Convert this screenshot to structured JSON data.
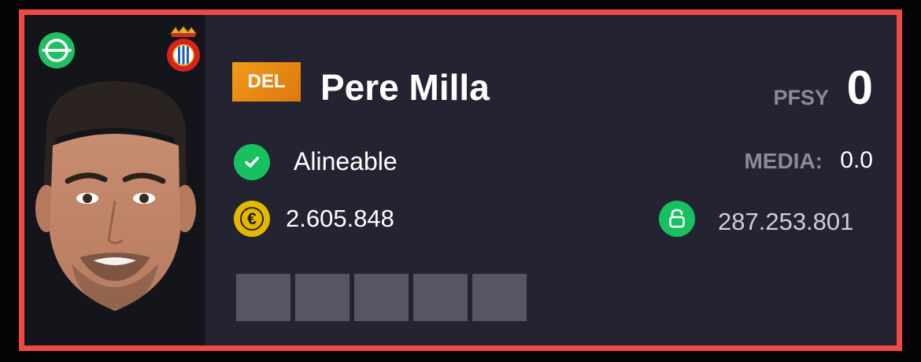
{
  "player": {
    "position": "DEL",
    "name": "Pere Milla",
    "status": "Alineable",
    "market_value": "2.605.848",
    "clause": "287.253.801"
  },
  "stats": {
    "pfsy_label": "PFSY",
    "pfsy_value": "0",
    "media_label": "MEDIA:",
    "media_value": "0.0"
  },
  "form": {
    "count": 5,
    "results": [
      "",
      "",
      "",
      "",
      ""
    ]
  },
  "icons": {
    "position": "position-circle-icon",
    "club": "club-crest-icon",
    "status": "checkmark-icon",
    "value": "euro-coin-icon",
    "clause": "unlock-icon"
  },
  "colors": {
    "border": "#ee4a43",
    "card_bg": "#232332",
    "accent_orange": "#f39b19",
    "green": "#18c160",
    "gold": "#e2b800",
    "muted": "#8a8a99",
    "form_box": "#565663"
  }
}
